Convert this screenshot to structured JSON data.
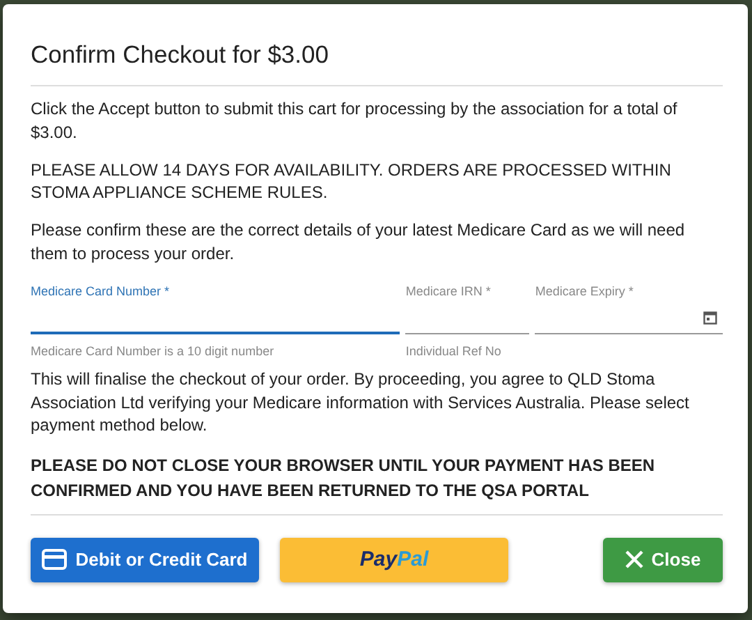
{
  "dialog": {
    "title": "Confirm Checkout for $3.00",
    "paragraphs": [
      {
        "text": "Click the Accept button to submit this cart for processing by the association for a total of $3.00."
      },
      {
        "text": "PLEASE ALLOW 14 DAYS FOR AVAILABILITY. ORDERS ARE PROCESSED WITHIN STOMA APPLIANCE SCHEME RULES."
      },
      {
        "text": "Please confirm these are the correct details of your latest Medicare Card as we will need them to process your order."
      }
    ],
    "fields": [
      {
        "kind": "text",
        "label": "Medicare Card Number *",
        "helper": "Medicare Card Number is a 10 digit number",
        "focused": true
      },
      {
        "kind": "text",
        "label": "Medicare IRN *",
        "helper": "Individual Ref No",
        "focused": false
      },
      {
        "kind": "date",
        "label": "Medicare Expiry *",
        "focused": false
      }
    ],
    "notice": "This will finalise the checkout of your order. By proceeding, you agree to QLD Stoma Association Ltd verifying your Medicare information with Services Australia. Please select payment method below.",
    "warning": "PLEASE DO NOT CLOSE YOUR BROWSER UNTIL YOUR PAYMENT HAS BEEN CONFIRMED AND YOU HAVE BEEN RETURNED TO THE QSA PORTAL",
    "buttons": [
      {
        "kind": "card",
        "label": "Debit or Credit Card"
      },
      {
        "kind": "paypal",
        "parts": [
          "Pay",
          "Pal"
        ]
      },
      {
        "kind": "close",
        "label": "Close"
      }
    ]
  }
}
